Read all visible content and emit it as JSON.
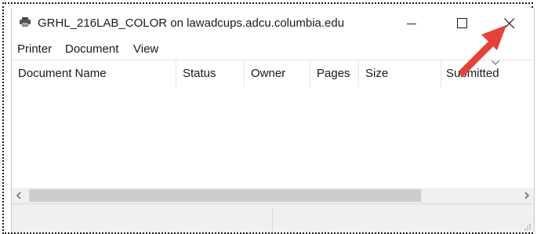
{
  "window": {
    "title": "GRHL_216LAB_COLOR on lawadcups.adcu.columbia.edu",
    "app_icon": "printer-icon"
  },
  "controls": {
    "minimize_icon": "minimize-icon",
    "maximize_icon": "maximize-icon",
    "close_icon": "close-icon"
  },
  "menu": {
    "items": [
      "Printer",
      "Document",
      "View"
    ]
  },
  "columns": [
    "Document Name",
    "Status",
    "Owner",
    "Pages",
    "Size",
    "Submitted"
  ],
  "rows": [],
  "annotation": {
    "arrow_color": "#e8403a",
    "points_to": "close-button"
  },
  "colors": {
    "accent_arrow": "#e8403a",
    "scroll_thumb": "#cdcdcd",
    "chrome": "#f0f0f0"
  }
}
